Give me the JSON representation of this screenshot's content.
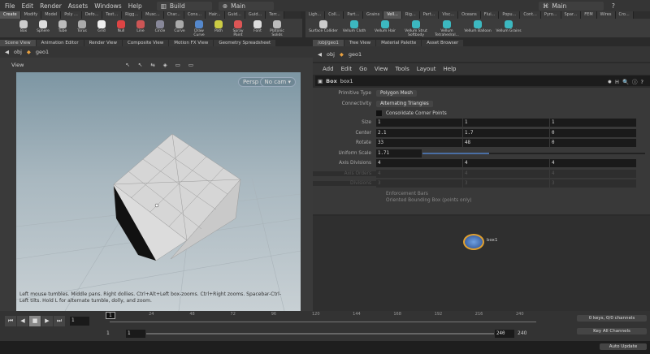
{
  "menubar": {
    "items": [
      "File",
      "Edit",
      "Render",
      "Assets",
      "Windows",
      "Help"
    ],
    "desktop": "Build",
    "context": "Main",
    "context_right": "Main"
  },
  "shelf_tabs_left": [
    "Create",
    "Modify",
    "Model",
    "Poly ...",
    "Defo...",
    "Text...",
    "Rigg...",
    "Musc...",
    "Char...",
    "Cons...",
    "Hair...",
    "Guid...",
    "Guid...",
    "Terr..."
  ],
  "shelf_tools_left": [
    "Box",
    "Sphere",
    "Tube",
    "Torus",
    "Grid",
    "Null",
    "Line",
    "Circle",
    "Curve",
    "Draw Curve",
    "Path",
    "Spray Paint",
    "Font",
    "Platonic Solids"
  ],
  "shelf_tabs_right": [
    "Ligh...",
    "Coll...",
    "Part...",
    "Grains",
    "Vell...",
    "Rig...",
    "Part...",
    "Visc...",
    "Oceans",
    "Flui...",
    "Popu...",
    "Cont...",
    "Pyro...",
    "Spar...",
    "FEM",
    "Wires",
    "Cro..."
  ],
  "shelf_tools_right": [
    "Surface Collider",
    "Vellum Cloth",
    "Vellum Hair",
    "Vellum Strut Softbody",
    "Vellum Tetrahedral...",
    "Vellum Balloon",
    "Vellum Grains"
  ],
  "left_pane": {
    "tabs": [
      "Scene View",
      "Animation Editor",
      "Render View",
      "Composite View",
      "Motion FX View",
      "Geometry Spreadsheet"
    ],
    "path": [
      "obj",
      "geo1"
    ],
    "view_label": "View",
    "camera": "Persp ▾",
    "cam_select": "No cam ▾",
    "hint": "Left mouse tumbles. Middle pans. Right dollies. Ctrl+Alt+Left box-zooms. Ctrl+Right zooms. Spacebar-Ctrl-Left tilts. Hold L for alternate tumble, dolly, and zoom."
  },
  "right_pane": {
    "tabs": [
      "/obj/geo1",
      "Tree View",
      "Material Palette",
      "Asset Browser"
    ],
    "path": [
      "obj",
      "geo1"
    ],
    "menu": [
      "Add",
      "Edit",
      "Go",
      "View",
      "Tools",
      "Layout",
      "Help"
    ],
    "node_type": "Box",
    "node_name": "box1",
    "params": {
      "primitive_type_label": "Primitive Type",
      "primitive_type": "Polygon Mesh",
      "connectivity_label": "Connectivity",
      "connectivity": "Alternating Triangles",
      "consolidate": "Consolidate Corner Points",
      "rows": [
        {
          "label": "Size",
          "values": [
            "1",
            "1",
            "1"
          ]
        },
        {
          "label": "Center",
          "values": [
            "2.1",
            "1.7",
            "0"
          ]
        },
        {
          "label": "Rotate",
          "values": [
            "33",
            "48",
            "0"
          ]
        }
      ],
      "uniform_scale_label": "Uniform Scale",
      "uniform_scale": "1.71",
      "uniform_scale_fraction": 0.3,
      "axis_div": {
        "label": "Axis Divisions",
        "values": [
          "4",
          "4",
          "4"
        ]
      },
      "axis_orders": {
        "label": "Axis Orders",
        "values": [
          "4",
          "4",
          "4"
        ]
      },
      "divisions": {
        "label": "Divisions",
        "values": [
          "3",
          "3",
          "3"
        ]
      },
      "enforcement": "Enforcement Bars",
      "oriented": "Oriented Bounding Box (points only)"
    },
    "network_node": "box1"
  },
  "timeline": {
    "current_frame": "1",
    "frame_field": "1",
    "ticks": [
      "24",
      "48",
      "72",
      "96",
      "120",
      "144",
      "168",
      "192",
      "216",
      "240"
    ],
    "start": "1",
    "range_start": "1",
    "range_end": "240",
    "end": "240",
    "keys": "0 keys, 0/0 channels",
    "key_all": "Key All Channels",
    "auto_update": "Auto Update"
  }
}
